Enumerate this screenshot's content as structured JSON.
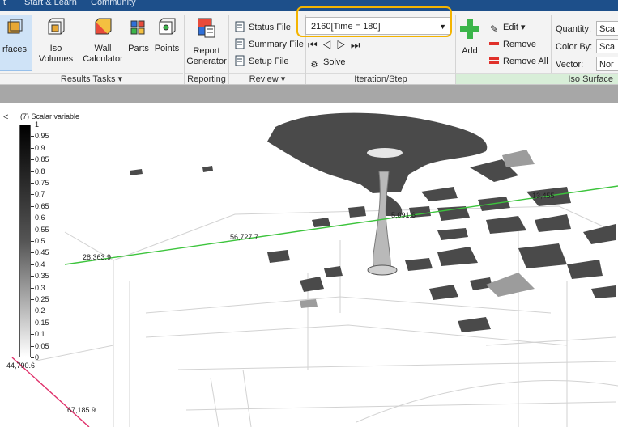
{
  "topbar": {
    "items": [
      "t",
      "Start & Learn",
      "Community"
    ]
  },
  "ribbon": {
    "results_tasks": {
      "buttons": [
        "rfaces",
        "Iso Volumes",
        "Wall Calculator",
        "Parts",
        "Points"
      ],
      "label": "Results Tasks"
    },
    "reporting": {
      "button": "Report Generator",
      "label": "Reporting"
    },
    "review": {
      "buttons": [
        "Status File",
        "Summary File",
        "Setup File"
      ],
      "label": "Review"
    },
    "iteration": {
      "selected": "2160[Time = 180]",
      "solve_label": "Solve",
      "label": "Iteration/Step"
    },
    "iso_surface": {
      "add_label": "Add",
      "edit_label": "Edit",
      "remove_label": "Remove",
      "remove_all_label": "Remove All",
      "quantity_label": "Quantity:",
      "quantity_value": "Sca",
      "colorby_label": "Color By:",
      "colorby_value": "Sca",
      "vector_label": "Vector:",
      "vector_value": "Nor",
      "label": "Iso Surface"
    }
  },
  "viewport": {
    "collapse_glyph": "<",
    "legend_title": "(7) Scalar variable",
    "legend_ticks": [
      "1",
      "0.95",
      "0.9",
      "0.85",
      "0.8",
      "0.75",
      "0.7",
      "0.65",
      "0.6",
      "0.55",
      "0.5",
      "0.45",
      "0.4",
      "0.35",
      "0.3",
      "0.25",
      "0.2",
      "0.15",
      "0.1",
      "0.05",
      "0"
    ],
    "labels": [
      "56,727.7",
      "28,363.9",
      "5,091.6",
      "13,455",
      "44,790.6",
      "67,185.9"
    ]
  },
  "colors": {
    "ribbon_bg": "#f3f3f3",
    "highlight": "#f4b400",
    "green_line": "#3cc43c",
    "red_line": "#e0306a",
    "iso_surface_band": "#d8eed8"
  }
}
